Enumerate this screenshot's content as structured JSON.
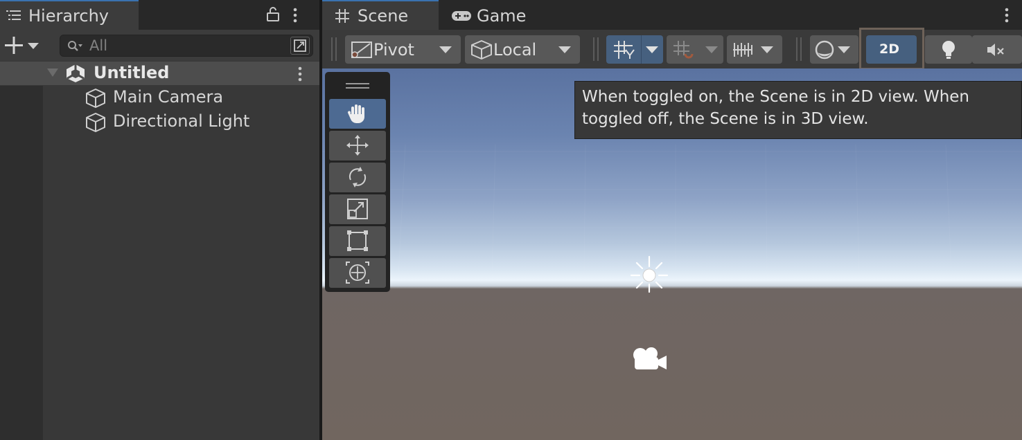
{
  "hierarchy": {
    "tab_label": "Hierarchy",
    "search_placeholder": "All",
    "scene_name": "Untitled",
    "items": [
      {
        "label": "Main Camera"
      },
      {
        "label": "Directional Light"
      }
    ]
  },
  "scene_window": {
    "tabs": [
      {
        "label": "Scene",
        "active": true
      },
      {
        "label": "Game",
        "active": false
      }
    ],
    "toolbar": {
      "pivot_label": "Pivot",
      "local_label": "Local",
      "toggle_2d_label": "2D",
      "toggle_2d_on": false
    },
    "tooltip": {
      "line1": "When toggled on, the Scene is in 2D view. When",
      "line2": "toggled off, the Scene is in 3D view."
    },
    "tools": [
      "hand-tool",
      "move-tool",
      "rotate-tool",
      "scale-tool",
      "rect-tool",
      "transform-tool"
    ],
    "active_tool": "hand-tool"
  },
  "colors": {
    "accent": "#3a72b0",
    "active_button": "#46607f",
    "panel": "#383838",
    "highlight_outline": "#6e6259"
  }
}
